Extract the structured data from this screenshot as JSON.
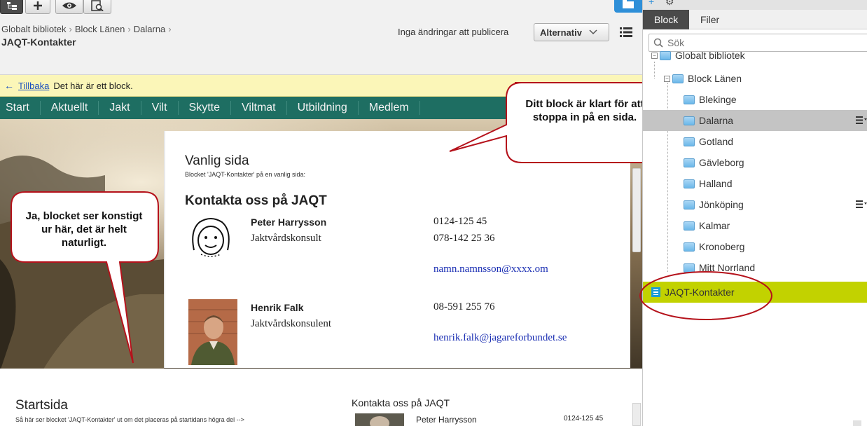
{
  "toolbar": {
    "buttons": [
      "tree-icon",
      "plus-icon",
      "eye-icon",
      "compare-icon"
    ]
  },
  "breadcrumb": {
    "items": [
      "Globalt bibliotek",
      "Block Länen",
      "Dalarna"
    ],
    "title": "JAQT-Kontakter"
  },
  "publish": {
    "status": "Inga ändringar att publicera",
    "alternatives_label": "Alternativ"
  },
  "notice": {
    "back_link": "Tillbaka",
    "message": "Det här är ett block."
  },
  "site_nav": [
    "Start",
    "Aktuellt",
    "Jakt",
    "Vilt",
    "Skytte",
    "Viltmat",
    "Utbildning",
    "Medlem"
  ],
  "block_preview": {
    "page_type": "Vanlig sida",
    "caption": "Blocket 'JAQT-Kontakter' på en vanlig sida:",
    "heading": "Kontakta oss på JAQT",
    "contacts": [
      {
        "name": "Peter Harrysson",
        "role": "Jaktvårdskonsult",
        "phone1": "0124-125 45",
        "phone2": "078-142 25 36",
        "email": "namn.namnsson@xxxx.om"
      },
      {
        "name": "Henrik Falk",
        "role": "Jaktvårdskonsulent",
        "phone1": "08-591 255 76",
        "email": "henrik.falk@jagareforbundet.se"
      }
    ]
  },
  "start_preview": {
    "page_type": "Startsida",
    "caption": "Så här ser blocket 'JAQT-Kontakter' ut om det placeras på startidans högra del -->",
    "heading": "Kontakta oss på JAQT",
    "contact_name": "Peter Harrysson",
    "contact_phone": "0124-125 45"
  },
  "callouts": {
    "right": "Ditt block är klart för att stoppa in på en sida.",
    "left": "Ja, blocket ser konstigt ur här, det är helt naturligt."
  },
  "panel": {
    "tabs": [
      "Block",
      "Filer"
    ],
    "active_tab": "Block",
    "search_placeholder": "Sök",
    "tree": {
      "root": "Globalt bibliotek",
      "group": "Block Länen",
      "folders": [
        "Blekinge",
        "Dalarna",
        "Gotland",
        "Gävleborg",
        "Halland",
        "Jönköping",
        "Kalmar",
        "Kronoberg",
        "Mitt Norrland"
      ],
      "selected_folder": "Dalarna",
      "block_item": "JAQT-Kontakter"
    }
  },
  "colors": {
    "nav_green": "#1e6e62",
    "notice_yellow": "#fbf6b8",
    "block_highlight": "#c2d200",
    "callout_border": "#b5121b",
    "link_blue": "#1b2fb3"
  }
}
